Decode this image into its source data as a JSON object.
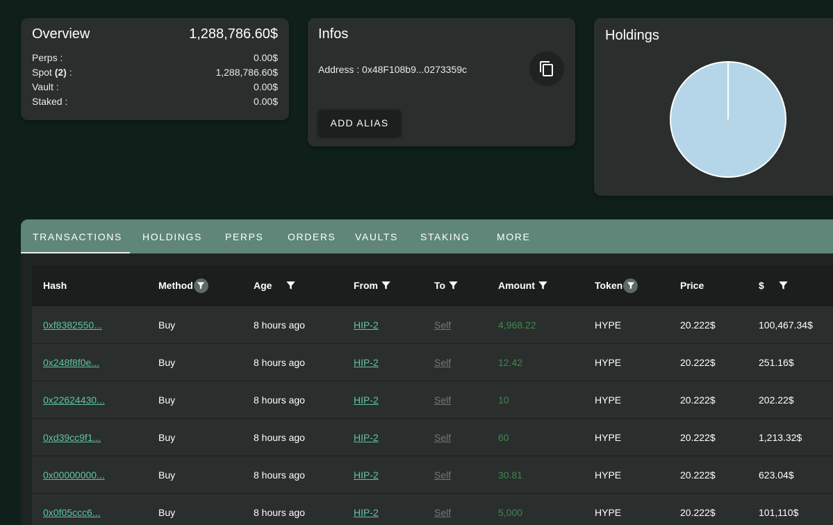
{
  "overview": {
    "title": "Overview",
    "total": "1,288,786.60$",
    "rows": [
      {
        "label": "Perps :",
        "count": "",
        "suffix": "",
        "value": "0.00$"
      },
      {
        "label": "Spot ",
        "count": "(2)",
        "suffix": " :",
        "value": "1,288,786.60$"
      },
      {
        "label": "Vault :",
        "count": "",
        "suffix": "",
        "value": "0.00$"
      },
      {
        "label": "Staked :",
        "count": "",
        "suffix": "",
        "value": "0.00$"
      }
    ]
  },
  "infos": {
    "title": "Infos",
    "address": "Address : 0x48F108b9...0273359c",
    "add_alias": "ADD ALIAS",
    "copy_icon": "copy-icon"
  },
  "holdings": {
    "title": "Holdings",
    "pie_color": "#b5d6e8",
    "chart_data": {
      "type": "pie",
      "slices": [
        {
          "value": 99.99
        },
        {
          "value": 0.01
        }
      ]
    }
  },
  "tabs": [
    "TRANSACTIONS",
    "HOLDINGS",
    "PERPS",
    "ORDERS",
    "VAULTS",
    "STAKING",
    "MORE"
  ],
  "active_tab": "TRANSACTIONS",
  "table": {
    "columns": [
      "Hash",
      "Method",
      "Age",
      "From",
      "To",
      "Amount",
      "Token",
      "Price",
      "$"
    ],
    "rows": [
      {
        "hash": "0xf8382550...",
        "method": "Buy",
        "age": "8 hours ago",
        "from": "HIP-2",
        "to": "Self",
        "amount": "4,968.22",
        "token": "HYPE",
        "price": "20.222$",
        "usd": "100,467.34$"
      },
      {
        "hash": "0x248f8f0e...",
        "method": "Buy",
        "age": "8 hours ago",
        "from": "HIP-2",
        "to": "Self",
        "amount": "12.42",
        "token": "HYPE",
        "price": "20.222$",
        "usd": "251.16$"
      },
      {
        "hash": "0x22624430...",
        "method": "Buy",
        "age": "8 hours ago",
        "from": "HIP-2",
        "to": "Self",
        "amount": "10",
        "token": "HYPE",
        "price": "20.222$",
        "usd": "202.22$"
      },
      {
        "hash": "0xd39cc9f1...",
        "method": "Buy",
        "age": "8 hours ago",
        "from": "HIP-2",
        "to": "Self",
        "amount": "60",
        "token": "HYPE",
        "price": "20.222$",
        "usd": "1,213.32$"
      },
      {
        "hash": "0x00000000...",
        "method": "Buy",
        "age": "8 hours ago",
        "from": "HIP-2",
        "to": "Self",
        "amount": "30.81",
        "token": "HYPE",
        "price": "20.222$",
        "usd": "623.04$"
      },
      {
        "hash": "0x0f05ccc6...",
        "method": "Buy",
        "age": "8 hours ago",
        "from": "HIP-2",
        "to": "Self",
        "amount": "5,000",
        "token": "HYPE",
        "price": "20.222$",
        "usd": "101,110$"
      }
    ]
  },
  "colors": {
    "background": "#0f201b",
    "card": "#2a2e2d",
    "tabbar": "#5f8678",
    "link": "#5fc6a4",
    "amount": "#3e8a4c"
  }
}
